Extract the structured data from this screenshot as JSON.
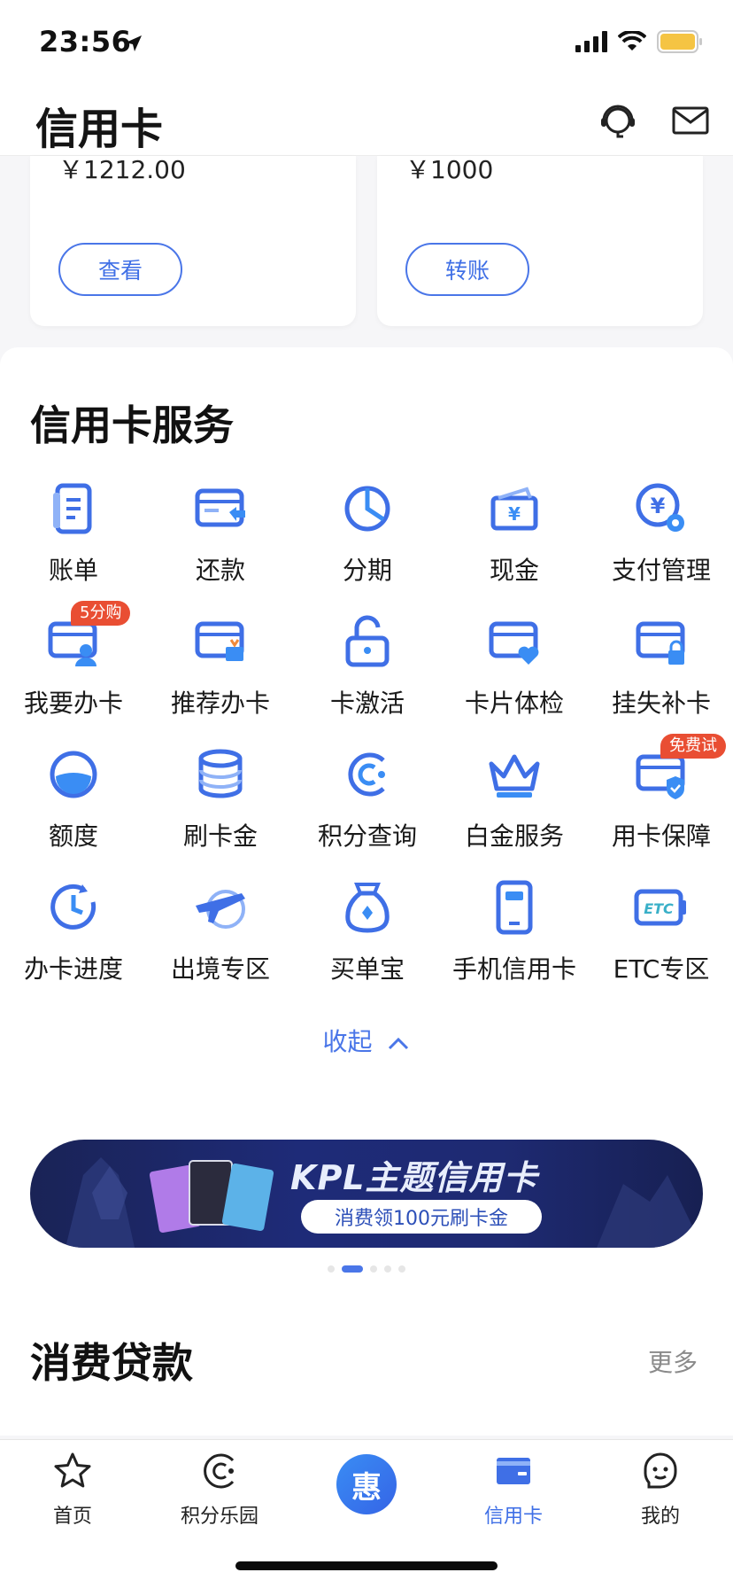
{
  "status_bar": {
    "time": "23:56"
  },
  "header": {
    "title": "信用卡"
  },
  "account_cards": [
    {
      "amount": "￥1212.00",
      "button": "查看"
    },
    {
      "amount": "￥1000",
      "button": "转账"
    }
  ],
  "services": {
    "title": "信用卡服务",
    "items": [
      {
        "label": "账单",
        "icon": "bill-icon"
      },
      {
        "label": "还款",
        "icon": "repay-icon"
      },
      {
        "label": "分期",
        "icon": "installment-icon"
      },
      {
        "label": "现金",
        "icon": "cash-icon"
      },
      {
        "label": "支付管理",
        "icon": "payment-settings-icon"
      },
      {
        "label": "我要办卡",
        "icon": "apply-card-icon",
        "badge": "5分购"
      },
      {
        "label": "推荐办卡",
        "icon": "recommend-card-icon"
      },
      {
        "label": "卡激活",
        "icon": "unlock-icon"
      },
      {
        "label": "卡片体检",
        "icon": "card-health-icon"
      },
      {
        "label": "挂失补卡",
        "icon": "lock-card-icon"
      },
      {
        "label": "额度",
        "icon": "limit-icon"
      },
      {
        "label": "刷卡金",
        "icon": "coin-stack-icon"
      },
      {
        "label": "积分查询",
        "icon": "points-icon"
      },
      {
        "label": "白金服务",
        "icon": "crown-icon"
      },
      {
        "label": "用卡保障",
        "icon": "shield-card-icon",
        "badge": "免费试"
      },
      {
        "label": "办卡进度",
        "icon": "clock-icon"
      },
      {
        "label": "出境专区",
        "icon": "airplane-icon"
      },
      {
        "label": "买单宝",
        "icon": "bag-icon"
      },
      {
        "label": "手机信用卡",
        "icon": "phone-icon"
      },
      {
        "label": "ETC专区",
        "icon": "etc-icon"
      }
    ],
    "collapse_label": "收起"
  },
  "banner": {
    "title": "KPL主题信用卡",
    "subtitle": "消费领100元刷卡金",
    "dots": 5,
    "active_dot": 1
  },
  "loans": {
    "title": "消费贷款",
    "more": "更多"
  },
  "tab_bar": {
    "tabs": [
      {
        "label": "首页",
        "icon": "star-icon"
      },
      {
        "label": "积分乐园",
        "icon": "points-icon"
      },
      {
        "label": "",
        "icon": "center-logo-icon",
        "glyph": "惠"
      },
      {
        "label": "信用卡",
        "icon": "credit-card-icon",
        "active": true
      },
      {
        "label": "我的",
        "icon": "profile-icon"
      }
    ]
  },
  "colors": {
    "accent": "#3f6fe6",
    "badge": "#e94e33",
    "banner": "#1e2b78"
  }
}
